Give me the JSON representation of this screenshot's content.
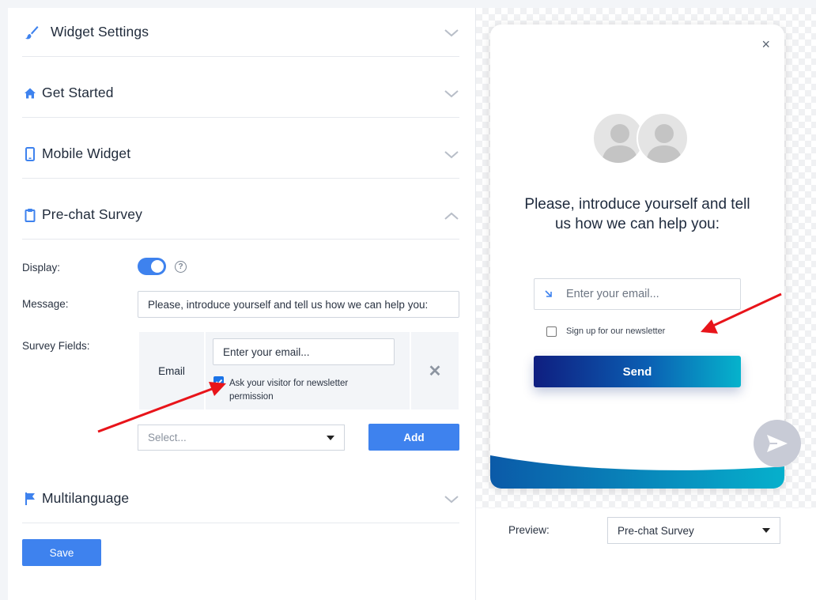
{
  "sections": {
    "widget_settings": "Widget Settings",
    "get_started": "Get Started",
    "mobile_widget": "Mobile Widget",
    "pre_chat_survey": "Pre-chat Survey",
    "multilanguage": "Multilanguage"
  },
  "survey": {
    "display_label": "Display:",
    "display_enabled": true,
    "help_glyph": "?",
    "message_label": "Message:",
    "message_value": "Please, introduce yourself and tell us how we can help you:",
    "fields_label": "Survey Fields:",
    "field_name": "Email",
    "field_placeholder": "Enter your email...",
    "newsletter_label": "Ask your visitor for newsletter permission",
    "newsletter_checked": true,
    "delete_glyph": "✕",
    "select_placeholder": "Select...",
    "add_label": "Add"
  },
  "save_label": "Save",
  "widget_preview": {
    "close_glyph": "×",
    "title": "Please, introduce yourself and tell us how we can help you:",
    "email_placeholder": "Enter your email...",
    "newsletter_label": "Sign up for our newsletter",
    "send_label": "Send"
  },
  "preview": {
    "label": "Preview:",
    "selected": "Pre-chat Survey"
  },
  "colors": {
    "accent": "#3e82ee",
    "send_gradient_start": "#0f1e80",
    "send_gradient_end": "#06b3cc",
    "annotation_arrow": "#e8141a"
  }
}
